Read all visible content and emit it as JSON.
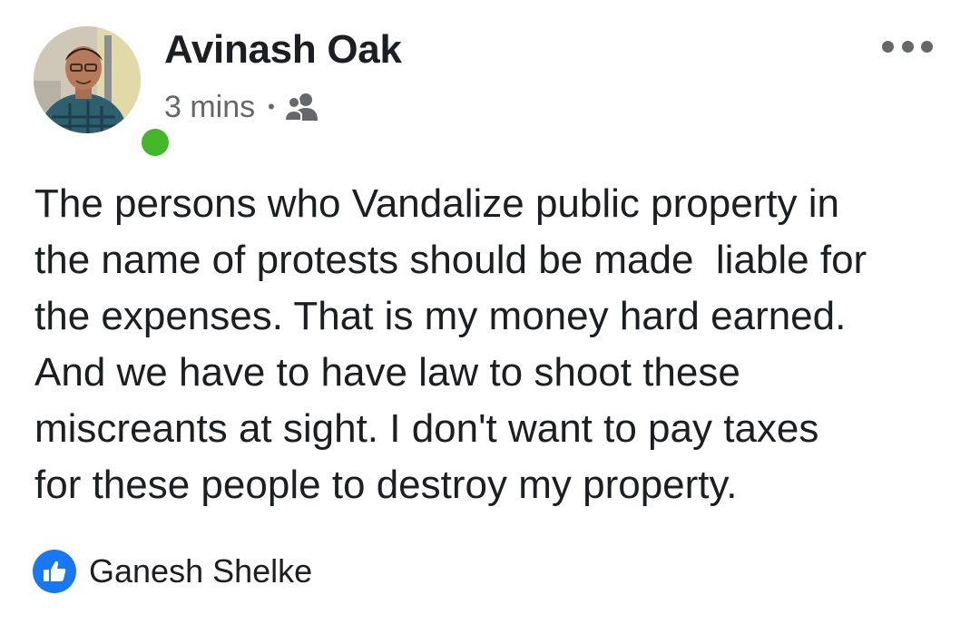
{
  "post": {
    "author": {
      "name": "Avinash Oak",
      "online": true
    },
    "timestamp": "3 mins",
    "separator": "•",
    "audience_icon": "friends-icon",
    "more_icon": "more-options-icon",
    "text_lines": [
      "The persons who Vandalize public property in",
      "the name of protests should be made  liable for",
      "the expenses. That is my money hard earned.",
      "And we have to have law to shoot these",
      "miscreants at sight. I don't want to pay taxes",
      "for these people to destroy my property."
    ],
    "reactions": {
      "icon": "like-icon",
      "reactor": "Ganesh Shelke"
    }
  },
  "colors": {
    "text": "#1c1e21",
    "secondary_text": "#65676b",
    "online_green": "#42b72a",
    "like_blue": "#1877f2"
  }
}
